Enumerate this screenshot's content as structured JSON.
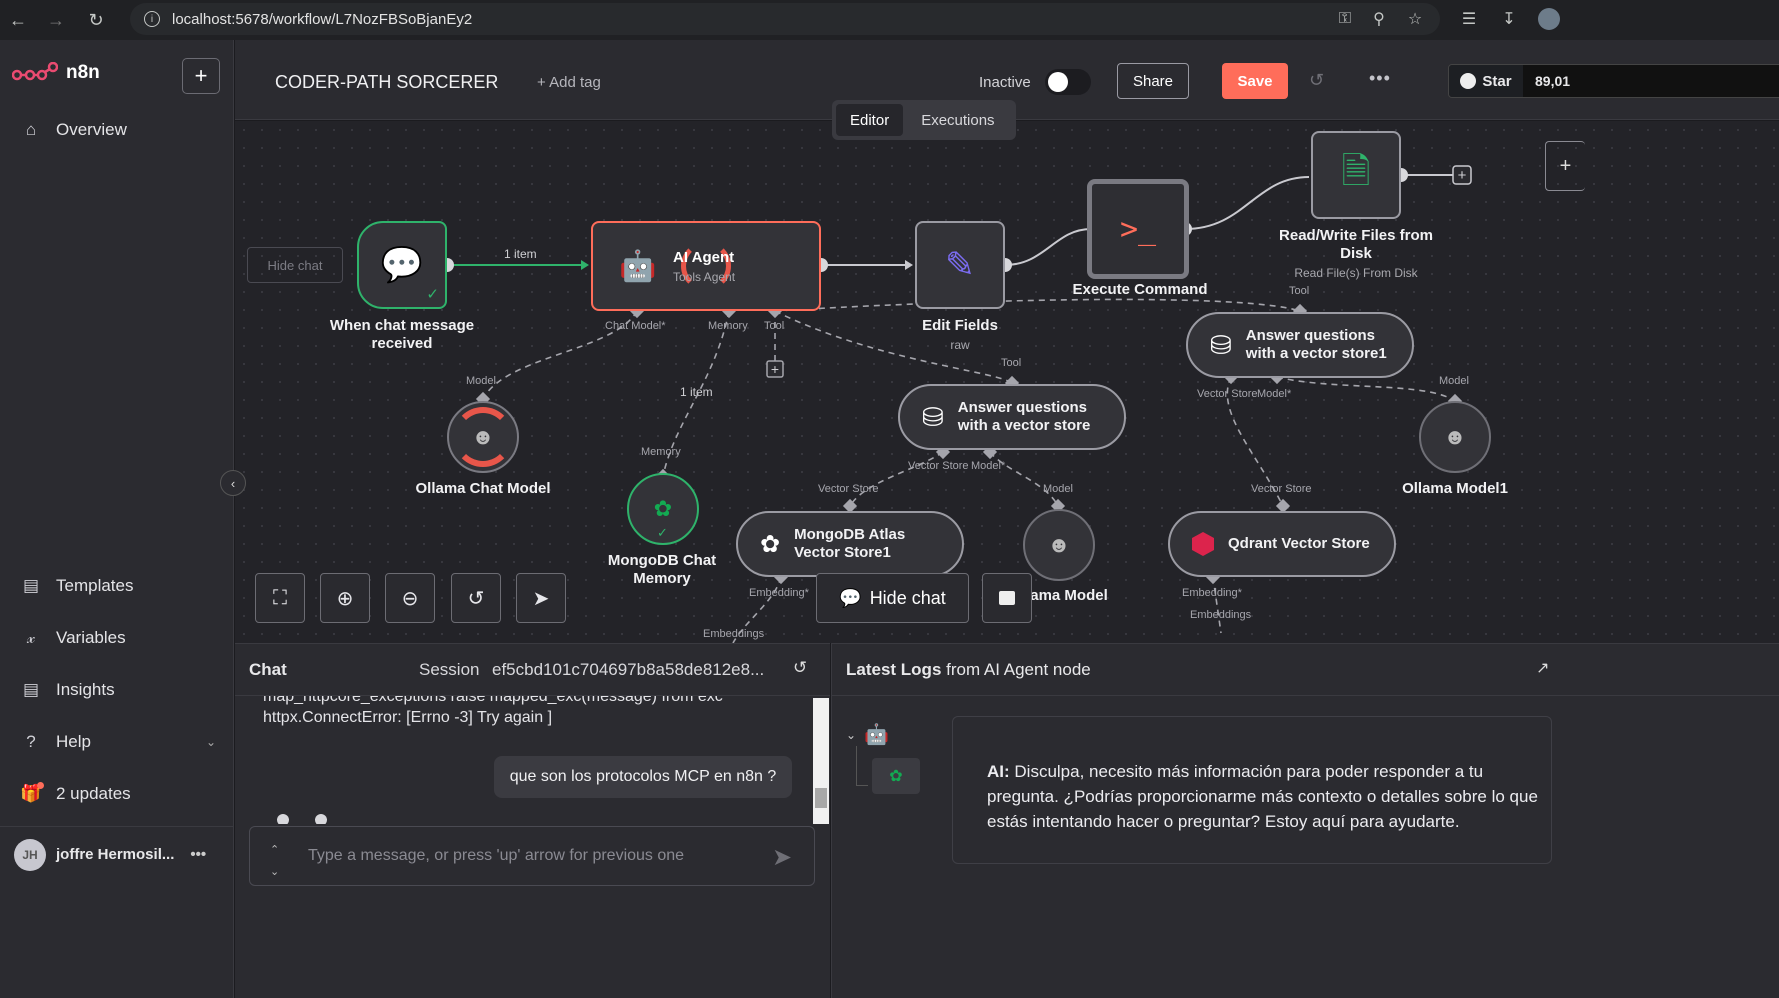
{
  "browser": {
    "url": "localhost:5678/workflow/L7NozFBSoBjanEy2",
    "icons": [
      "back-icon",
      "forward-icon",
      "reload-icon",
      "site-info-icon",
      "key-icon",
      "zoom-icon",
      "star-icon",
      "media-icon",
      "download-icon",
      "profile-icon"
    ]
  },
  "sidebar": {
    "brand": "n8n",
    "items": [
      {
        "label": "Overview",
        "icon": "home-icon"
      },
      {
        "label": "Templates",
        "icon": "templates-icon"
      },
      {
        "label": "Variables",
        "icon": "variables-icon"
      },
      {
        "label": "Insights",
        "icon": "insights-icon"
      },
      {
        "label": "Help",
        "icon": "help-icon"
      },
      {
        "label": "2 updates",
        "icon": "gift-icon"
      }
    ],
    "user": {
      "initials": "JH",
      "name": "joffre Hermosil..."
    }
  },
  "header": {
    "workflow_name": "CODER-PATH SORCERER",
    "add_tag": "+ Add tag",
    "status_label": "Inactive",
    "active": false,
    "share": "Share",
    "save": "Save",
    "github_star": "Star",
    "github_count": "89,01"
  },
  "tabs": {
    "editor": "Editor",
    "executions": "Executions",
    "active": "Editor"
  },
  "canvas": {
    "hide_chat_small": "Hide chat",
    "hide_chat_button": "Hide chat",
    "nodes": {
      "trigger": {
        "label_1": "When chat message",
        "label_2": "received"
      },
      "agent": {
        "title": "AI Agent",
        "subtitle": "Tools Agent"
      },
      "edit_fields": {
        "label": "Edit Fields",
        "sub": "raw"
      },
      "execute": {
        "label": "Execute Command"
      },
      "readwrite": {
        "label_1": "Read/Write Files from",
        "label_2": "Disk",
        "sub": "Read File(s) From Disk"
      },
      "ollama_chat": {
        "label": "Ollama Chat Model"
      },
      "mongo_memory": {
        "label_1": "MongoDB Chat",
        "label_2": "Memory"
      },
      "aq1": {
        "line_1": "Answer questions",
        "line_2": "with a vector store"
      },
      "aq2": {
        "line_1": "Answer questions",
        "line_2": "with a vector store1"
      },
      "mongo_vs": {
        "line_1": "MongoDB Atlas",
        "line_2": "Vector Store1"
      },
      "ollama_model": {
        "label": "Ollama Model"
      },
      "ollama_model1": {
        "label": "Ollama Model1"
      },
      "qdrant": {
        "label": "Qdrant Vector Store"
      }
    },
    "ports": {
      "chat_model": "Chat Model*",
      "memory": "Memory",
      "tool": "Tool",
      "model": "Model",
      "vector_store": "Vector Store",
      "vector_store_req": "Vector Store",
      "model_req": "Model*",
      "embedding": "Embedding*",
      "embeddings": "Embeddings"
    },
    "edge_labels": {
      "one_item": "1 item"
    }
  },
  "chat": {
    "title": "Chat",
    "session_label": "Session",
    "session_id": "ef5cbd101c704697b8a58de812e8...",
    "error_line_1": "map_httpcore_exceptions raise mapped_exc(message) from exc",
    "error_line_2": "httpx.ConnectError: [Errno -3] Try again ]",
    "user_message": "que son los protocolos MCP en n8n ?",
    "input_placeholder": "Type a message, or press 'up' arrow for previous one"
  },
  "logs": {
    "title_bold": "Latest Logs",
    "title_rest": " from AI Agent node",
    "ai_prefix": "AI:",
    "ai_message": " Disculpa, necesito más información para poder responder a tu pregunta. ¿Podrías proporcionarme más contexto o detalles sobre lo que estás intentando hacer o preguntar? Estoy aquí para ayudarte."
  },
  "colors": {
    "accent": "#ff6d5a",
    "success": "#2fb36b",
    "canvas_bg": "#232328"
  }
}
